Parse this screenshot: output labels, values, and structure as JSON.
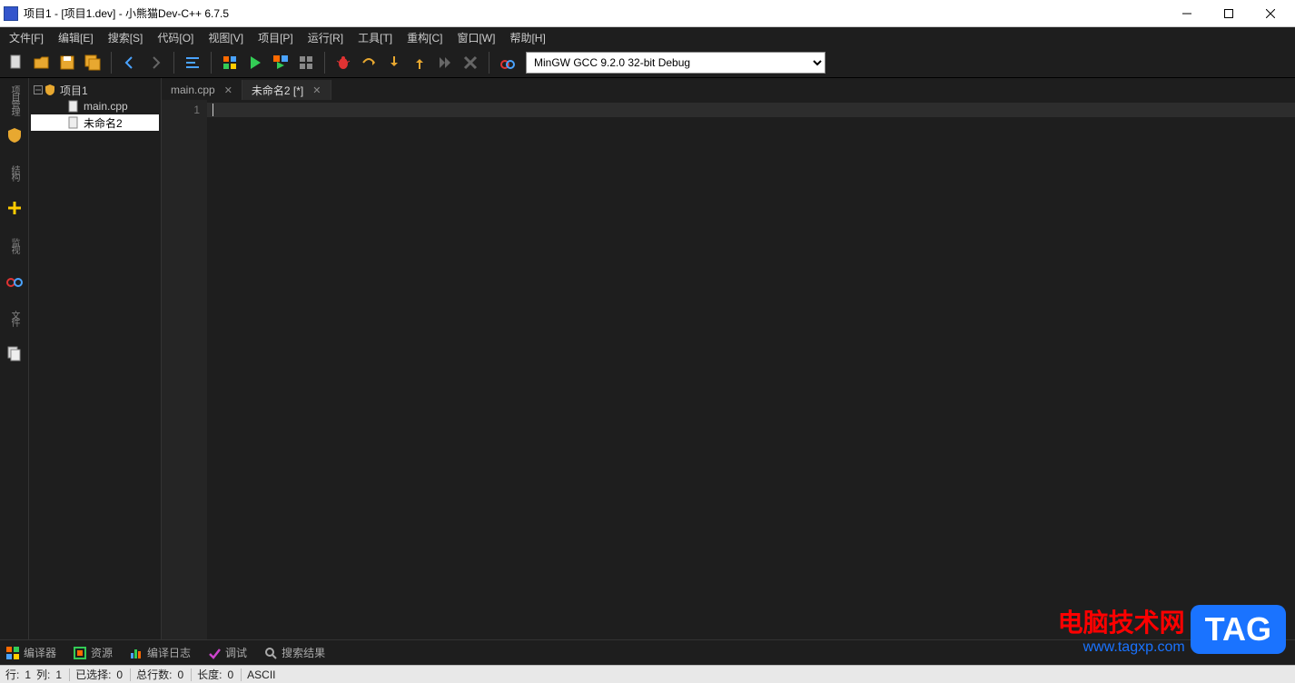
{
  "window": {
    "title": "项目1 - [项目1.dev] - 小熊猫Dev-C++ 6.7.5"
  },
  "menu": {
    "items": [
      "文件[F]",
      "编辑[E]",
      "搜索[S]",
      "代码[O]",
      "视图[V]",
      "项目[P]",
      "运行[R]",
      "工具[T]",
      "重构[C]",
      "窗口[W]",
      "帮助[H]"
    ]
  },
  "toolbar": {
    "compiler_selected": "MinGW GCC 9.2.0 32-bit Debug"
  },
  "left_rail": {
    "items": [
      {
        "label": "项目管理"
      },
      {
        "label": "结构"
      },
      {
        "label": "监视"
      },
      {
        "label": "文件"
      }
    ]
  },
  "project_tree": {
    "root": "项目1",
    "children": [
      "main.cpp",
      "未命名2"
    ],
    "selected_index": 1
  },
  "tabs": {
    "items": [
      {
        "label": "main.cpp",
        "active": false
      },
      {
        "label": "未命名2 [*]",
        "active": true
      }
    ]
  },
  "editor": {
    "gutter_lines": [
      "1"
    ],
    "content": ""
  },
  "bottom_tabs": {
    "items": [
      "编译器",
      "资源",
      "编译日志",
      "调试",
      "搜索结果"
    ]
  },
  "statusbar": {
    "line_label": "行:",
    "line_value": "1",
    "col_label": "列:",
    "col_value": "1",
    "selected_label": "已选择:",
    "selected_value": "0",
    "total_lines_label": "总行数:",
    "total_lines_value": "0",
    "length_label": "长度:",
    "length_value": "0",
    "encoding": "ASCII"
  },
  "watermark": {
    "line1": "电脑技术网",
    "line2": "www.tagxp.com",
    "badge": "TAG"
  }
}
